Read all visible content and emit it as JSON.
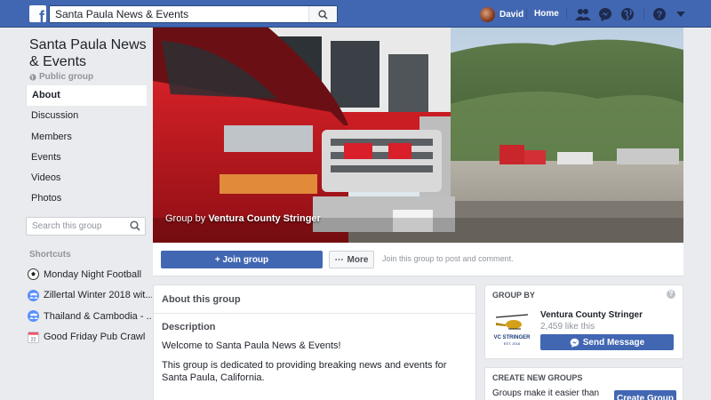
{
  "topbar": {
    "search_value": "Santa Paula News & Events",
    "user_name": "David",
    "home_label": "Home"
  },
  "group": {
    "title": "Santa Paula News & Events",
    "privacy": "Public group"
  },
  "sidebar": {
    "items": [
      {
        "label": "About"
      },
      {
        "label": "Discussion"
      },
      {
        "label": "Members"
      },
      {
        "label": "Events"
      },
      {
        "label": "Videos"
      },
      {
        "label": "Photos"
      }
    ],
    "search_placeholder": "Search this group"
  },
  "shortcuts": {
    "heading": "Shortcuts",
    "items": [
      {
        "label": "Monday Night Football",
        "icon": "soccer-ball-icon"
      },
      {
        "label": "Zillertal Winter 2018 wit...",
        "icon": "group-icon"
      },
      {
        "label": "Thailand & Cambodia - ...",
        "icon": "group-icon"
      },
      {
        "label": "Good Friday Pub Crawl",
        "icon": "calendar-icon"
      }
    ]
  },
  "cover": {
    "caption_prefix": "Group by",
    "caption_author": "Ventura County Stringer"
  },
  "actions": {
    "join_label": "+ Join group",
    "more_label": "More",
    "hint": "Join this group to post and comment."
  },
  "about": {
    "heading": "About this group",
    "description_heading": "Description",
    "paragraphs": [
      "Welcome to Santa Paula News & Events!",
      "This group is dedicated to providing breaking news and events for Santa Paula, California."
    ]
  },
  "group_by": {
    "heading": "GROUP BY",
    "page_name": "Ventura County Stringer",
    "likes": "2,459 like this",
    "message_label": "Send Message",
    "logo_text": "VC STRINGER",
    "logo_subtext": "EST. 2016"
  },
  "create_groups": {
    "heading": "CREATE NEW GROUPS",
    "text": "Groups make it easier than",
    "button_label": "Create Group"
  },
  "colors": {
    "brand_blue": "#4267b2",
    "page_bg": "#e9ebee"
  }
}
